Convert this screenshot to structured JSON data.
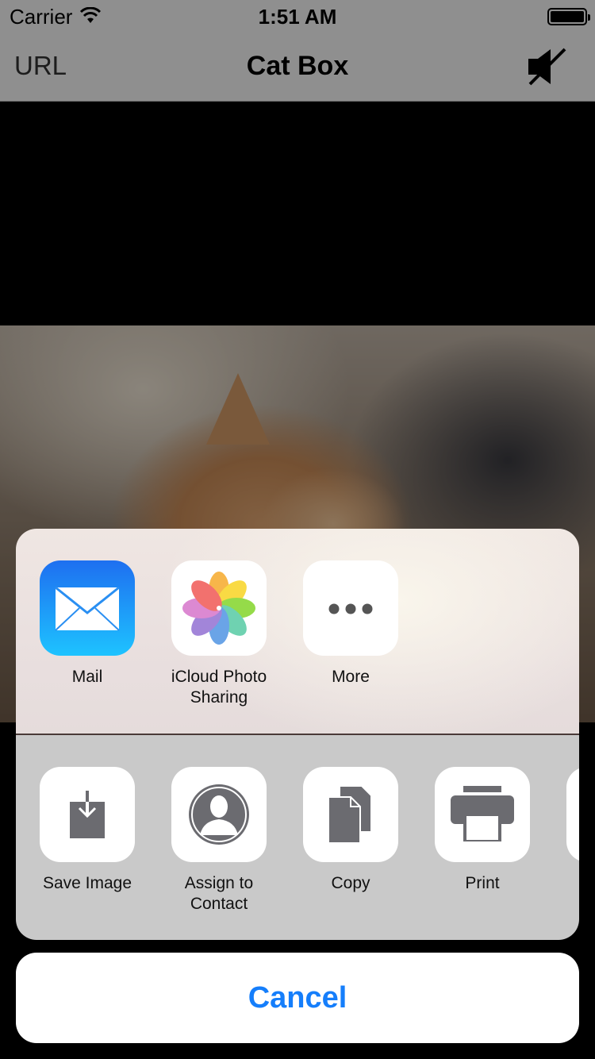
{
  "status_bar": {
    "carrier": "Carrier",
    "time": "1:51 AM"
  },
  "nav_bar": {
    "left_label": "URL",
    "title": "Cat Box",
    "right_icon": "speaker-muted-icon"
  },
  "share_sheet": {
    "apps": [
      {
        "label": "Mail",
        "icon": "mail-icon"
      },
      {
        "label": "iCloud Photo\nSharing",
        "icon": "photos-icon"
      },
      {
        "label": "More",
        "icon": "more-icon"
      }
    ],
    "actions": [
      {
        "label": "Save Image",
        "icon": "save-image-icon"
      },
      {
        "label": "Assign to\nContact",
        "icon": "contact-icon"
      },
      {
        "label": "Copy",
        "icon": "copy-icon"
      },
      {
        "label": "Print",
        "icon": "print-icon"
      }
    ],
    "cancel_label": "Cancel"
  },
  "colors": {
    "accent": "#157efb",
    "icon_gray": "#6b6b70"
  }
}
